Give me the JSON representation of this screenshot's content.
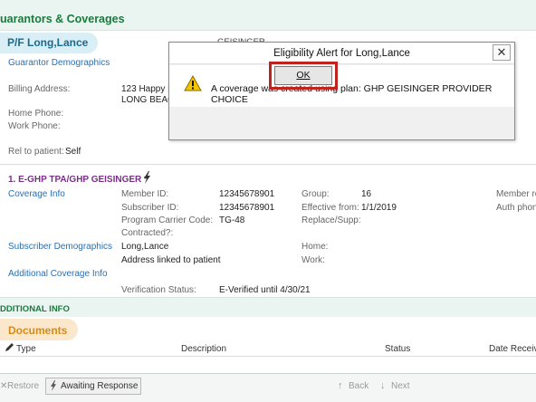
{
  "header": {
    "title": "uarantors & Coverages"
  },
  "guarantor": {
    "name": "P/F Long,Lance",
    "demographics_link": "Guarantor Demographics",
    "payer_partial": "GEISINGER",
    "billing_address_label": "Billing Address:",
    "billing_address_line1": "123 Happy L",
    "billing_address_line2": "LONG BEAC",
    "home_phone_label": "Home Phone:",
    "work_phone_label": "Work Phone:",
    "rel_label": "Rel to patient:",
    "rel_value": "Self"
  },
  "coverage": {
    "title": "1. E-GHP TPA/GHP GEISINGER *",
    "lightning_icon": "lightning-icon",
    "coverage_info_link": "Coverage Info",
    "subscriber_demographics_link": "Subscriber Demographics",
    "additional_info_link": "Additional Coverage Info",
    "member_id_label": "Member ID:",
    "member_id_value": "12345678901",
    "subscriber_id_label": "Subscriber ID:",
    "subscriber_id_value": "12345678901",
    "program_carrier_label": "Program Carrier Code:",
    "program_carrier_value": "TG-48",
    "contracted_label": "Contracted?:",
    "group_label": "Group:",
    "group_value": "16",
    "effective_label": "Effective from:",
    "effective_value": "1/1/2019",
    "replace_label": "Replace/Supp:",
    "member_rel_label": "Member re",
    "auth_phone_label": "Auth phon",
    "subscriber_name": "Long,Lance",
    "address_linked": "Address linked to patient",
    "home_label": "Home:",
    "work_label": "Work:",
    "verification_label": "Verification Status:",
    "verification_value": "E-Verified until 4/30/21"
  },
  "additional_info": {
    "title": "DDITIONAL INFO"
  },
  "documents": {
    "title": "Documents",
    "columns": [
      "Type",
      "Description",
      "Status",
      "Date Receive"
    ]
  },
  "toolbar": {
    "restore": "Restore",
    "awaiting": "Awaiting Response",
    "back": "Back",
    "next": "Next"
  },
  "dialog": {
    "title": "Eligibility Alert for Long,Lance",
    "close": "✕",
    "message": "A coverage was created using plan: GHP GEISINGER PROVIDER CHOICE",
    "ok": "OK"
  },
  "colors": {
    "header_bg": "#eaf4f0",
    "pill_bg": "#d9eef5",
    "documents_pill_bg": "#fbe8cc",
    "documents_text": "#d98a12",
    "coverage_title": "#7b2d8b",
    "link": "#2a6fb0",
    "ok_outline": "#c0231d",
    "warning": "#f5c400"
  }
}
